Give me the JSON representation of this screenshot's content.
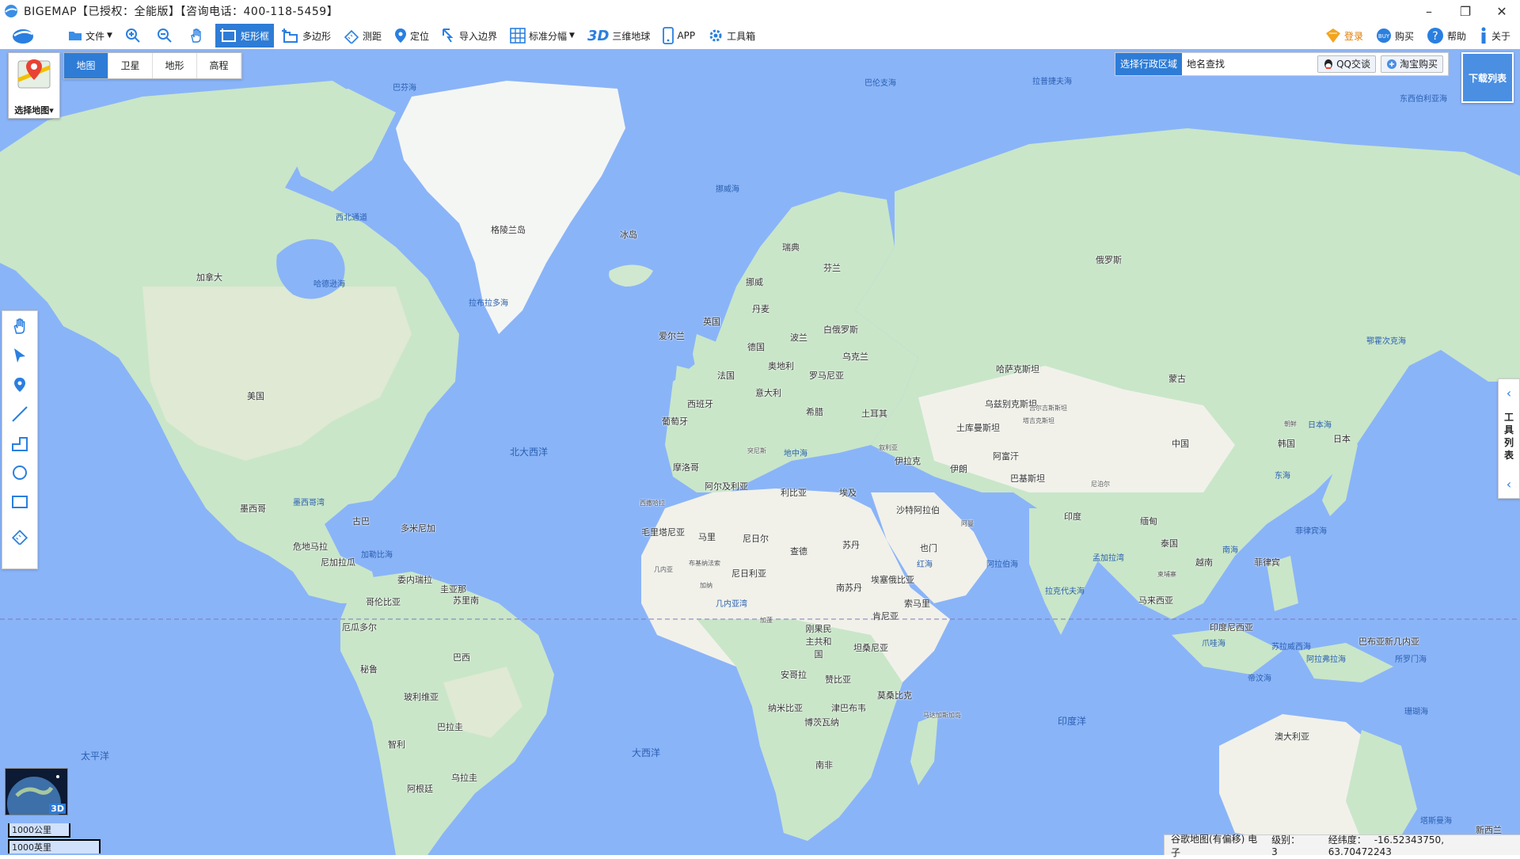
{
  "app": {
    "title": "BIGEMAP【已授权：全能版】【咨询电话：400-118-5459】"
  },
  "toolbar": {
    "items": [
      {
        "label": "文件",
        "icon": "folder-icon"
      },
      {
        "label": "",
        "icon": "zoom-in-icon"
      },
      {
        "label": "",
        "icon": "zoom-out-icon"
      },
      {
        "label": "",
        "icon": "pan-hand-icon"
      },
      {
        "label": "矩形框",
        "icon": "rectangle-select-icon"
      },
      {
        "label": "多边形",
        "icon": "polygon-select-icon"
      },
      {
        "label": "测距",
        "icon": "ruler-icon"
      },
      {
        "label": "定位",
        "icon": "location-pin-icon"
      },
      {
        "label": "导入边界",
        "icon": "import-boundary-icon"
      },
      {
        "label": "标准分幅",
        "icon": "grid-icon"
      },
      {
        "label": "三维地球",
        "icon": "3d-icon"
      },
      {
        "label": "APP",
        "icon": "phone-icon"
      },
      {
        "label": "工具箱",
        "icon": "gear-icon"
      }
    ],
    "right": [
      {
        "label": "登录",
        "icon": "vip-icon"
      },
      {
        "label": "购买",
        "icon": "buy-icon"
      },
      {
        "label": "帮助",
        "icon": "help-icon"
      },
      {
        "label": "关于",
        "icon": "info-icon"
      }
    ]
  },
  "map_selector": {
    "label": "选择地图",
    "tabs": [
      {
        "label": "地图",
        "active": true
      },
      {
        "label": "卫星",
        "active": false
      },
      {
        "label": "地形",
        "active": false
      },
      {
        "label": "高程",
        "active": false
      }
    ]
  },
  "search": {
    "region_label": "选择行政区域",
    "place_label": "地名查找",
    "qq_label": "QQ交谈",
    "taobao_label": "淘宝购买"
  },
  "download_list": {
    "label": "下载列表"
  },
  "right_panel": {
    "label": "工具列表"
  },
  "globe3d": {
    "badge": "3D"
  },
  "scale": {
    "km": "1000公里",
    "mi": "1000英里"
  },
  "status": {
    "source": "谷歌地图(有偏移) 电子",
    "level_label": "级别：",
    "level": "3",
    "coord_label": "经纬度：",
    "coords": "-16.52343750, 63.70472243"
  },
  "map_labels": {
    "countries": {
      "greenland": "格陵兰岛",
      "iceland": "冰岛",
      "canada": "加拿大",
      "usa": "美国",
      "mexico": "墨西哥",
      "cuba": "古巴",
      "dominica": "多米尼加",
      "guatemala": "危地马拉",
      "nicaragua": "尼加拉瓜",
      "venezuela": "委内瑞拉",
      "guyana": "圭亚那",
      "suriname": "苏里南",
      "colombia": "哥伦比亚",
      "ecuador": "厄瓜多尔",
      "peru": "秘鲁",
      "brazil": "巴西",
      "bolivia": "玻利维亚",
      "paraguay": "巴拉圭",
      "chile": "智利",
      "uruguay": "乌拉圭",
      "argentina": "阿根廷",
      "uk": "英国",
      "ireland": "爱尔兰",
      "norway": "挪威",
      "sweden": "瑞典",
      "finland": "芬兰",
      "denmark": "丹麦",
      "germany": "德国",
      "poland": "波兰",
      "belarus": "白俄罗斯",
      "ukraine": "乌克兰",
      "france": "法国",
      "austria": "奥地利",
      "romania": "罗马尼亚",
      "italy": "意大利",
      "spain": "西班牙",
      "portugal": "葡萄牙",
      "greece": "希腊",
      "turkey": "土耳其",
      "russia": "俄罗斯",
      "kazakhstan": "哈萨克斯坦",
      "mongolia": "蒙古",
      "uzbekistan": "乌兹别克斯坦",
      "kyrgyzstan": "吉尔吉斯斯坦",
      "turkmenistan": "土库曼斯坦",
      "tajikistan": "塔吉克斯坦",
      "afghanistan": "阿富汗",
      "pakistan": "巴基斯坦",
      "iran": "伊朗",
      "iraq": "伊拉克",
      "syria": "叙利亚",
      "saudi": "沙特阿拉伯",
      "oman": "阿曼",
      "yemen": "也门",
      "india": "印度",
      "nepal": "尼泊尔",
      "china": "中国",
      "north_korea": "朝鲜",
      "south_korea": "韩国",
      "japan": "日本",
      "myanmar": "缅甸",
      "thailand": "泰国",
      "cambodia": "柬埔寨",
      "vietnam": "越南",
      "philippines": "菲律宾",
      "malaysia": "马来西亚",
      "indonesia": "印度尼西亚",
      "png": "巴布亚新几内亚",
      "australia": "澳大利亚",
      "new_zealand": "新西兰",
      "morocco": "摩洛哥",
      "algeria": "阿尔及利亚",
      "libya": "利比亚",
      "egypt": "埃及",
      "tunisia": "突尼斯",
      "western_sahara": "西撒哈拉",
      "mauritania": "毛里塔尼亚",
      "mali": "马里",
      "niger": "尼日尔",
      "chad": "查德",
      "sudan": "苏丹",
      "south_sudan": "南苏丹",
      "ethiopia": "埃塞俄比亚",
      "somalia": "索马里",
      "kenya": "肯尼亚",
      "nigeria": "尼日利亚",
      "guinea": "几内亚",
      "burkina": "布基纳法索",
      "ghana": "加纳",
      "gabon": "加蓬",
      "drc": "刚果民主共和国",
      "tanzania": "坦桑尼亚",
      "angola": "安哥拉",
      "zambia": "赞比亚",
      "mozambique": "莫桑比克",
      "namibia": "纳米比亚",
      "zimbabwe": "津巴布韦",
      "botswana": "博茨瓦纳",
      "madagascar": "马达加斯加岛",
      "south_africa": "南非"
    },
    "seas": {
      "baffin": "巴芬海",
      "baffin_bay": "巴伦支海",
      "laptev": "拉普捷夫海",
      "east_siberian": "东西伯利亚海",
      "norwegian": "挪威海",
      "hudson": "哈德逊海",
      "nw_passage": "西北通道",
      "labrador": "拉布拉多海",
      "north_atlantic": "北大西洋",
      "mediterranean": "地中海",
      "gulf_mexico": "墨西哥湾",
      "caribbean": "加勒比海",
      "gulf_guinea": "几内亚湾",
      "red_sea": "红海",
      "arabian": "阿拉伯海",
      "bengal": "孟加拉湾",
      "laccadive": "拉克代夫海",
      "south_china": "南海",
      "east_china": "东海",
      "sea_japan": "日本海",
      "okhotsk": "鄂霍次克海",
      "philippine": "菲律宾海",
      "celebes": "苏拉威西海",
      "arafura": "阿拉弗拉海",
      "solomon": "所罗门海",
      "coral": "珊瑚海",
      "tasman": "塔斯曼海",
      "timor": "帝汶海",
      "java": "爪哇海"
    },
    "oceans": {
      "pacific": "太平洋",
      "atlantic": "大西洋",
      "indian": "印度洋"
    }
  }
}
